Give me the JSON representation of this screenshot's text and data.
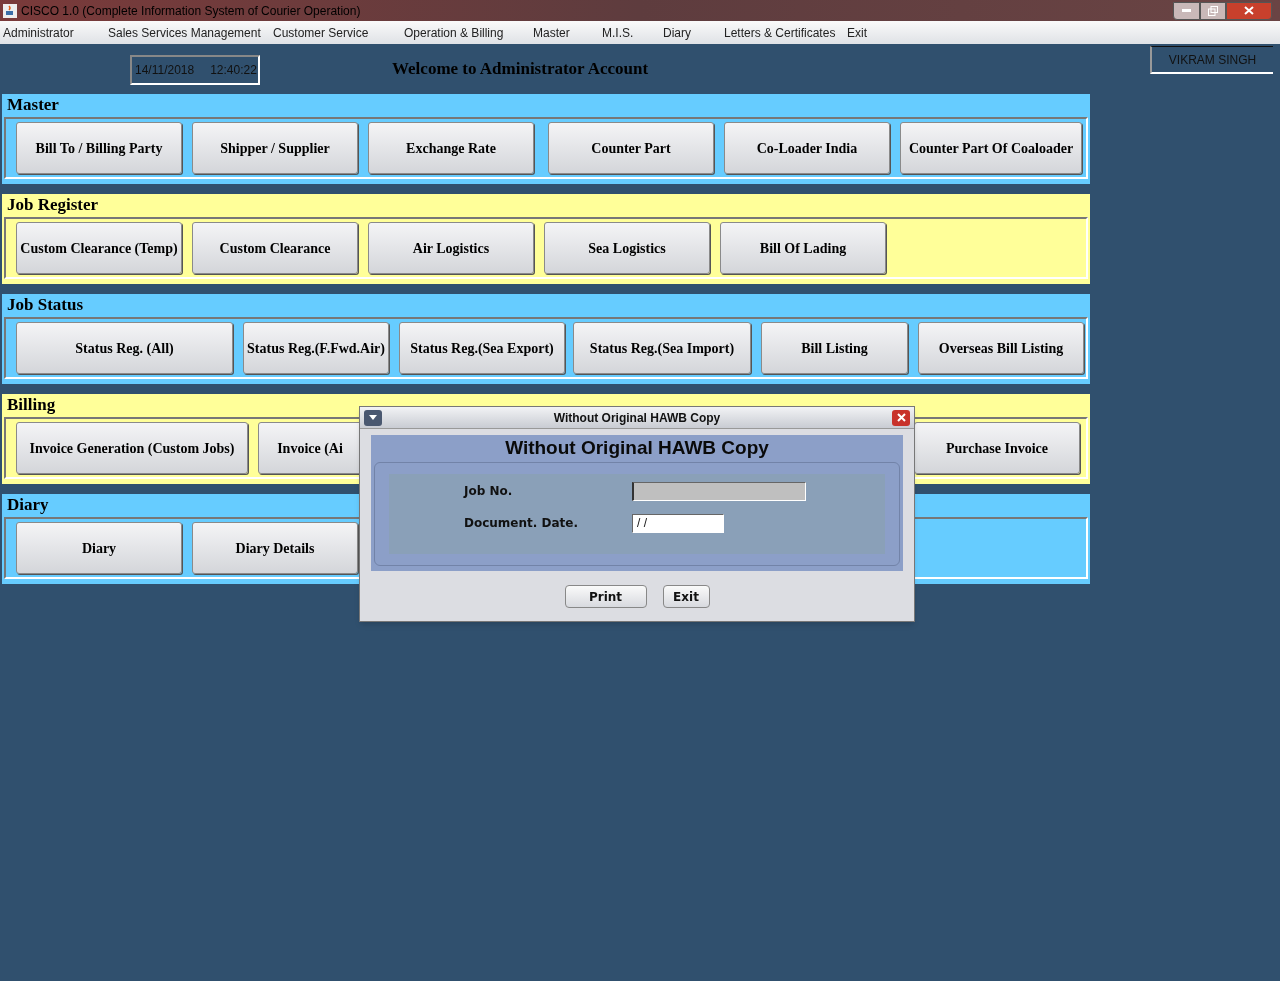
{
  "window": {
    "title": "CISCO 1.0 (Complete Information System of Courier Operation)"
  },
  "menu": [
    "Administrator",
    "Sales Services Management",
    "Customer Service",
    "Operation & Billing",
    "Master",
    "M.I.S.",
    "Diary",
    "Letters & Certificates",
    "Exit"
  ],
  "header": {
    "date": "14/11/2018",
    "time": "12:40:22",
    "welcome": "Welcome to Administrator Account",
    "user": "VIKRAM SINGH"
  },
  "sections": [
    {
      "title": "Master",
      "color": "#66ccff",
      "buttons": [
        "Bill To / Billing Party",
        "Shipper / Supplier",
        "Exchange Rate",
        "Counter Part",
        "Co-Loader India",
        "Counter Part Of Coaloader"
      ]
    },
    {
      "title": "Job Register",
      "color": "#ffff99",
      "buttons": [
        "Custom Clearance (Temp)",
        "Custom Clearance",
        "Air Logistics",
        "Sea Logistics",
        "Bill Of Lading"
      ]
    },
    {
      "title": "Job Status",
      "color": "#66ccff",
      "buttons": [
        "Status Reg. (All)",
        "Status Reg.(F.Fwd.Air)",
        "Status Reg.(Sea Export)",
        "Status Reg.(Sea Import)",
        "Bill Listing",
        "Overseas Bill Listing"
      ]
    },
    {
      "title": "Billing",
      "color": "#ffff99",
      "buttons": [
        "Invoice Generation (Custom Jobs)",
        "Invoice (Ai",
        "Purchase Invoice"
      ]
    },
    {
      "title": "Diary",
      "color": "#66ccff",
      "buttons": [
        "Diary",
        "Diary Details"
      ]
    }
  ],
  "dialog": {
    "title": "Without Original HAWB Copy",
    "heading": "Without Original HAWB Copy",
    "fields": [
      {
        "label": "Job No.",
        "disabled": true
      },
      {
        "label": "Document. Date.",
        "value": "/ /",
        "disabled": false
      }
    ],
    "buttons": [
      "Print",
      "Exit"
    ]
  }
}
